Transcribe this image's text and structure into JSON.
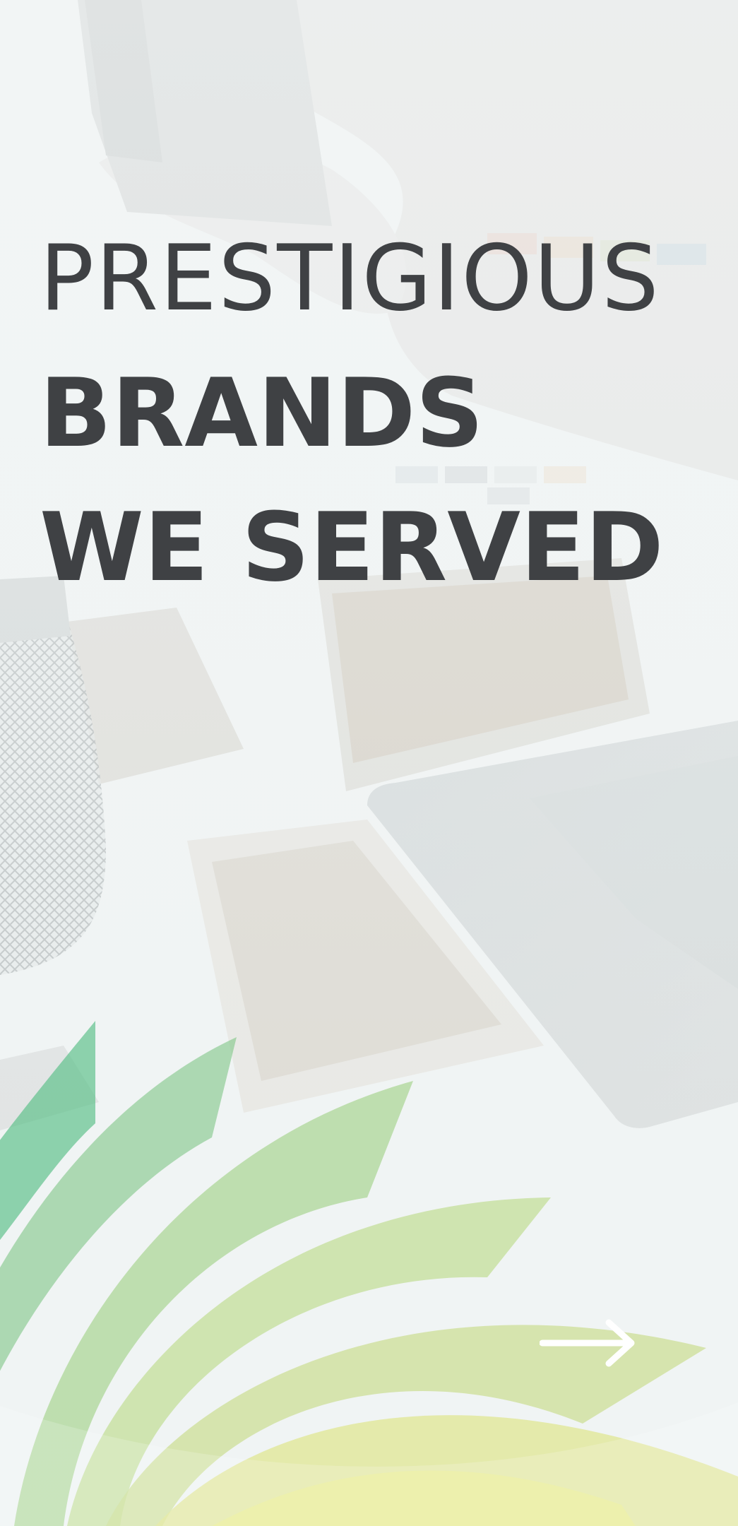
{
  "headline": {
    "line1": "PRESTIGIOUS",
    "line2": "BRANDS",
    "line3": "WE SERVED"
  },
  "icons": {
    "next": "arrow-right-icon"
  },
  "colors": {
    "text": "#3f4144",
    "arrow": "#ffffff",
    "leaf_teal": "#5cc08a",
    "leaf_green": "#a9d37a",
    "leaf_yellow": "#e4e98a"
  }
}
